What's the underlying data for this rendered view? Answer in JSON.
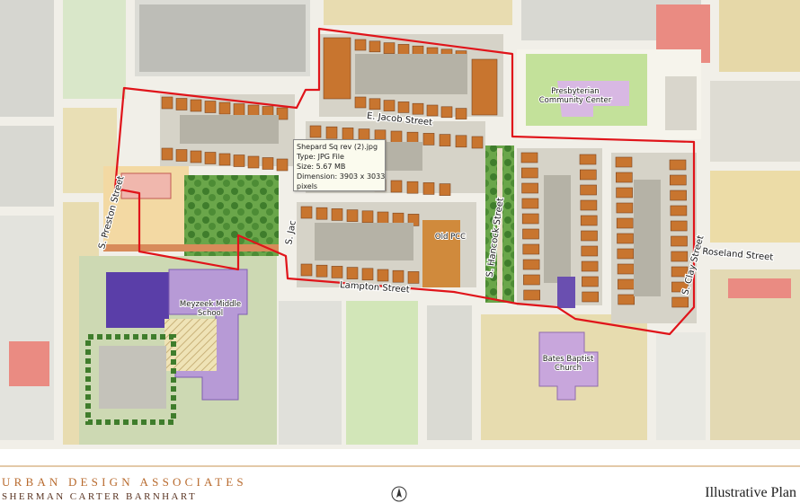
{
  "streets": {
    "e_jacob": "E. Jacob Street",
    "s_preston": "S. Preston Street",
    "s_jackson": "S. Jac",
    "s_hancock": "S. Hancock Street",
    "s_clay": "S. Clay Street",
    "roseland": "Roseland Street",
    "lampton": "Lampton Street"
  },
  "places": {
    "presbyterian_line1": "Presbyterian",
    "presbyterian_line2": "Community Center",
    "meyzeek_line1": "Meyzeek Middle",
    "meyzeek_line2": "School",
    "old_pcc": "Old PCC",
    "bates_line1": "Bates Baptist",
    "bates_line2": "Church"
  },
  "tooltip": {
    "filename": "Shepard Sq rev (2).jpg",
    "type": "Type: JPG File",
    "size": "Size: 5.67 MB",
    "dimension": "Dimension: 3903 x 3033",
    "dimension_unit": "pixels"
  },
  "footer": {
    "firm_name": "URBAN DESIGN ASSOCIATES",
    "partner_name": "SHERMAN CARTER BARNHART",
    "plan_title": "Illustrative Plan"
  },
  "colors": {
    "boundary": "#e0141a",
    "roof": "#c8752f",
    "school": "#b79ad6",
    "school_dark": "#5a3ea8",
    "presbyterian": "#b6d98c",
    "church": "#c8a6dc",
    "park": "#5b9a3a",
    "street": "#f1efe8"
  }
}
